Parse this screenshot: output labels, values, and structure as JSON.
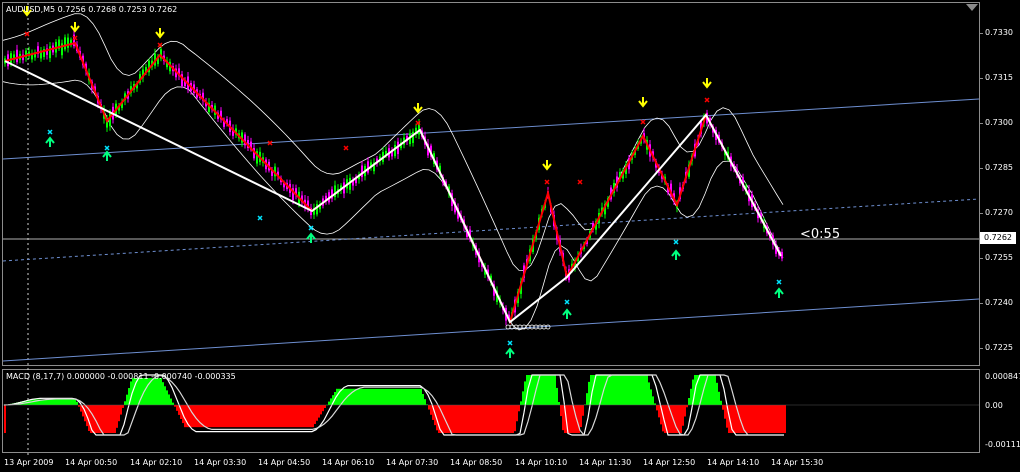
{
  "symbol_label": "AUDUSD,M5  0.7256 0.7268 0.7253 0.7262",
  "current_price": "0.7262",
  "bar_timer": "<0:55",
  "macd_label": "MACD  (8,17,7) 0.000000 -0.000811 -0.000740 -0.000335",
  "price_ticks": [
    "0.7330",
    "0.7315",
    "0.7300",
    "0.7285",
    "0.7270",
    "0.7255",
    "0.7240",
    "0.7225"
  ],
  "macd_ticks": [
    "0.000847",
    "0.00",
    "-0.00111"
  ],
  "time_labels": [
    "13 Apr 2009",
    "14 Apr 00:50",
    "14 Apr 02:10",
    "14 Apr 03:30",
    "14 Apr 04:50",
    "14 Apr 06:10",
    "14 Apr 07:30",
    "14 Apr 08:50",
    "14 Apr 10:10",
    "14 Apr 11:30",
    "14 Apr 12:50",
    "14 Apr 14:10",
    "14 Apr 15:30"
  ],
  "colors": {
    "background": "#000000",
    "bull_bar": "#00ff00",
    "bear_bar": "#ff00ff",
    "zigzag_primary": "#ffffff",
    "zigzag_secondary": "#ff0000",
    "channel": "#6e8fd1",
    "bands": "#ffffff",
    "arrow_down": "#ffff00",
    "arrow_up": "#00ff7f",
    "marker_top": "#ff0000",
    "marker_bottom": "#00e5ff",
    "macd_pos": "#00ff00",
    "macd_neg": "#ff0000"
  },
  "chart_data": {
    "type": "candlestick",
    "symbol": "AUDUSD",
    "timeframe": "M5",
    "ohlc_last": {
      "open": 0.7256,
      "high": 0.7268,
      "low": 0.7253,
      "close": 0.7262
    },
    "ylim": [
      0.7218,
      0.7339
    ],
    "zigzag_points": [
      {
        "t": "13 Apr 23:55",
        "price": 0.732
      },
      {
        "t": "14 Apr 00:50",
        "price": 0.7326
      },
      {
        "t": "14 Apr 01:10",
        "price": 0.73
      },
      {
        "t": "14 Apr 02:10",
        "price": 0.7322
      },
      {
        "t": "14 Apr 04:50",
        "price": 0.727
      },
      {
        "t": "14 Apr 07:30",
        "price": 0.7297
      },
      {
        "t": "14 Apr 08:50",
        "price": 0.7233
      },
      {
        "t": "14 Apr 10:10",
        "price": 0.7276
      },
      {
        "t": "14 Apr 10:40",
        "price": 0.7248
      },
      {
        "t": "14 Apr 12:40",
        "price": 0.7295
      },
      {
        "t": "14 Apr 13:20",
        "price": 0.7272
      },
      {
        "t": "14 Apr 14:10",
        "price": 0.7302
      },
      {
        "t": "14 Apr 15:25",
        "price": 0.7255
      }
    ],
    "macd": {
      "fast": 8,
      "slow": 17,
      "signal": 7,
      "values": [
        0.0,
        -0.000811,
        -0.00074,
        -0.000335
      ]
    }
  }
}
